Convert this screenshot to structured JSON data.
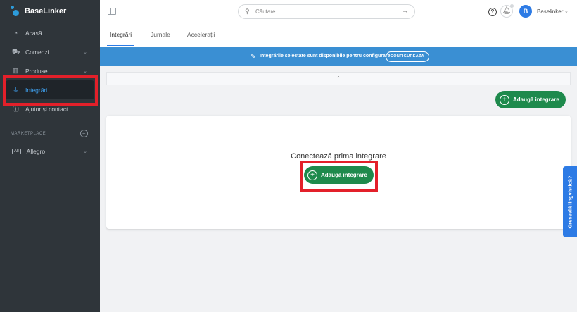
{
  "app": {
    "brand": "BaseLinker"
  },
  "sidebar": {
    "items": [
      {
        "label": "Acasă",
        "icon": "dashboard-icon"
      },
      {
        "label": "Comenzi",
        "icon": "cart-icon"
      },
      {
        "label": "Produse",
        "icon": "products-icon"
      },
      {
        "label": "Integrări",
        "icon": "plug-icon",
        "active": true
      },
      {
        "label": "Ajutor și contact",
        "icon": "help-icon"
      }
    ],
    "section_label": "MARKETPLACE",
    "marketplace": {
      "badge": "All",
      "label": "Allegro"
    }
  },
  "topbar": {
    "search_placeholder": "Căutare...",
    "user_initial": "B",
    "user_name": "Baselinker"
  },
  "tabs": [
    {
      "label": "Integrări",
      "active": true
    },
    {
      "label": "Jurnale"
    },
    {
      "label": "Accelerații"
    }
  ],
  "banner": {
    "text": "Integrările selectate sunt disponibile pentru configurare",
    "button": "CONFIGUREAZĂ"
  },
  "actions": {
    "add_integration": "Adaugă integrare"
  },
  "card": {
    "title": "Conectează prima integrare",
    "button": "Adaugă integrare"
  },
  "feedback": {
    "label": "Greșeală lingvistică?"
  },
  "colors": {
    "sidebar_bg": "#2f353a",
    "accent_blue": "#2d7be5",
    "banner_blue": "#3a8fd3",
    "green": "#1e8a4c",
    "highlight_red": "#e3202a"
  }
}
